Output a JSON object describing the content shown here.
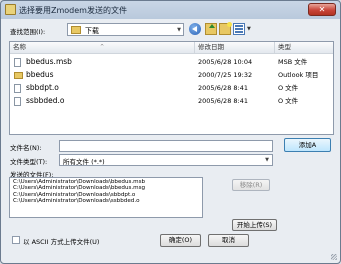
{
  "window": {
    "title": "选择要用Zmodem发送的文件",
    "close_glyph": "✕"
  },
  "toolbar": {
    "lookin_label": "查找范围(I):",
    "lookin_value": "下载",
    "view_arrow": "▼",
    "icons": [
      "back-icon",
      "up-folder-icon",
      "new-folder-icon",
      "view-menu-icon"
    ]
  },
  "filelist": {
    "columns": [
      "名称",
      "修改日期",
      "类型"
    ],
    "sort_glyph": "^",
    "rows": [
      {
        "name": "bbedus.msb",
        "date": "2005/6/28 10:04",
        "type": "MSB 文件",
        "icon": "file-icon"
      },
      {
        "name": "bbedus",
        "date": "2000/7/25 19:32",
        "type": "Outlook 项目",
        "icon": "folder-icon"
      },
      {
        "name": "sbbdpt.o",
        "date": "2005/6/28 8:41",
        "type": "O 文件",
        "icon": "file-icon"
      },
      {
        "name": "ssbbded.o",
        "date": "2005/6/28 8:41",
        "type": "O 文件",
        "icon": "file-icon"
      }
    ]
  },
  "filename": {
    "label": "文件名(N):",
    "value": "",
    "add_button": "添加A"
  },
  "filetype": {
    "label": "文件类型(T):",
    "value": "所有文件 (*.*)",
    "arrow": "▼"
  },
  "sending": {
    "label": "发送的文件(F):",
    "items": [
      "C:\\Users\\Administrator\\Downloads\\bbedus.msb",
      "C:\\Users\\Administrator\\Downloads\\bbedus.msg",
      "C:\\Users\\Administrator\\Downloads\\sbbdpt.o",
      "C:\\Users\\Administrator\\Downloads\\ssbbded.o"
    ],
    "remove_button": "移除(R)",
    "start_button": "开始上传(S)"
  },
  "footer": {
    "ascii_label": "以 ASCII 方式上传文件(U)",
    "ascii_checked": false,
    "ok_button": "确定(O)",
    "cancel_button": "取消"
  },
  "colors": {
    "accent": "#3c7fb1",
    "close": "#c9463a",
    "folder": "#e8c863"
  }
}
